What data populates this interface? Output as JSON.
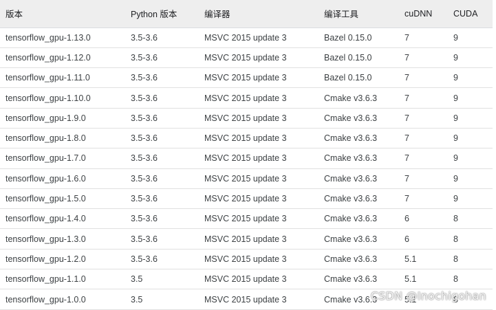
{
  "table": {
    "headers": [
      "版本",
      "Python 版本",
      "编译器",
      "编译工具",
      "cuDNN",
      "CUDA"
    ],
    "rows": [
      [
        "tensorflow_gpu-1.13.0",
        "3.5-3.6",
        "MSVC 2015 update 3",
        "Bazel 0.15.0",
        "7",
        "9"
      ],
      [
        "tensorflow_gpu-1.12.0",
        "3.5-3.6",
        "MSVC 2015 update 3",
        "Bazel 0.15.0",
        "7",
        "9"
      ],
      [
        "tensorflow_gpu-1.11.0",
        "3.5-3.6",
        "MSVC 2015 update 3",
        "Bazel 0.15.0",
        "7",
        "9"
      ],
      [
        "tensorflow_gpu-1.10.0",
        "3.5-3.6",
        "MSVC 2015 update 3",
        "Cmake v3.6.3",
        "7",
        "9"
      ],
      [
        "tensorflow_gpu-1.9.0",
        "3.5-3.6",
        "MSVC 2015 update 3",
        "Cmake v3.6.3",
        "7",
        "9"
      ],
      [
        "tensorflow_gpu-1.8.0",
        "3.5-3.6",
        "MSVC 2015 update 3",
        "Cmake v3.6.3",
        "7",
        "9"
      ],
      [
        "tensorflow_gpu-1.7.0",
        "3.5-3.6",
        "MSVC 2015 update 3",
        "Cmake v3.6.3",
        "7",
        "9"
      ],
      [
        "tensorflow_gpu-1.6.0",
        "3.5-3.6",
        "MSVC 2015 update 3",
        "Cmake v3.6.3",
        "7",
        "9"
      ],
      [
        "tensorflow_gpu-1.5.0",
        "3.5-3.6",
        "MSVC 2015 update 3",
        "Cmake v3.6.3",
        "7",
        "9"
      ],
      [
        "tensorflow_gpu-1.4.0",
        "3.5-3.6",
        "MSVC 2015 update 3",
        "Cmake v3.6.3",
        "6",
        "8"
      ],
      [
        "tensorflow_gpu-1.3.0",
        "3.5-3.6",
        "MSVC 2015 update 3",
        "Cmake v3.6.3",
        "6",
        "8"
      ],
      [
        "tensorflow_gpu-1.2.0",
        "3.5-3.6",
        "MSVC 2015 update 3",
        "Cmake v3.6.3",
        "5.1",
        "8"
      ],
      [
        "tensorflow_gpu-1.1.0",
        "3.5",
        "MSVC 2015 update 3",
        "Cmake v3.6.3",
        "5.1",
        "8"
      ],
      [
        "tensorflow_gpu-1.0.0",
        "3.5",
        "MSVC 2015 update 3",
        "Cmake v3.6.3",
        "5.1",
        "8"
      ]
    ]
  },
  "watermark": "CSDN @Inochigohan",
  "colors": {
    "header_bg": "#eeeeee",
    "row_border": "#e0e0e0",
    "text": "#3c4043"
  }
}
